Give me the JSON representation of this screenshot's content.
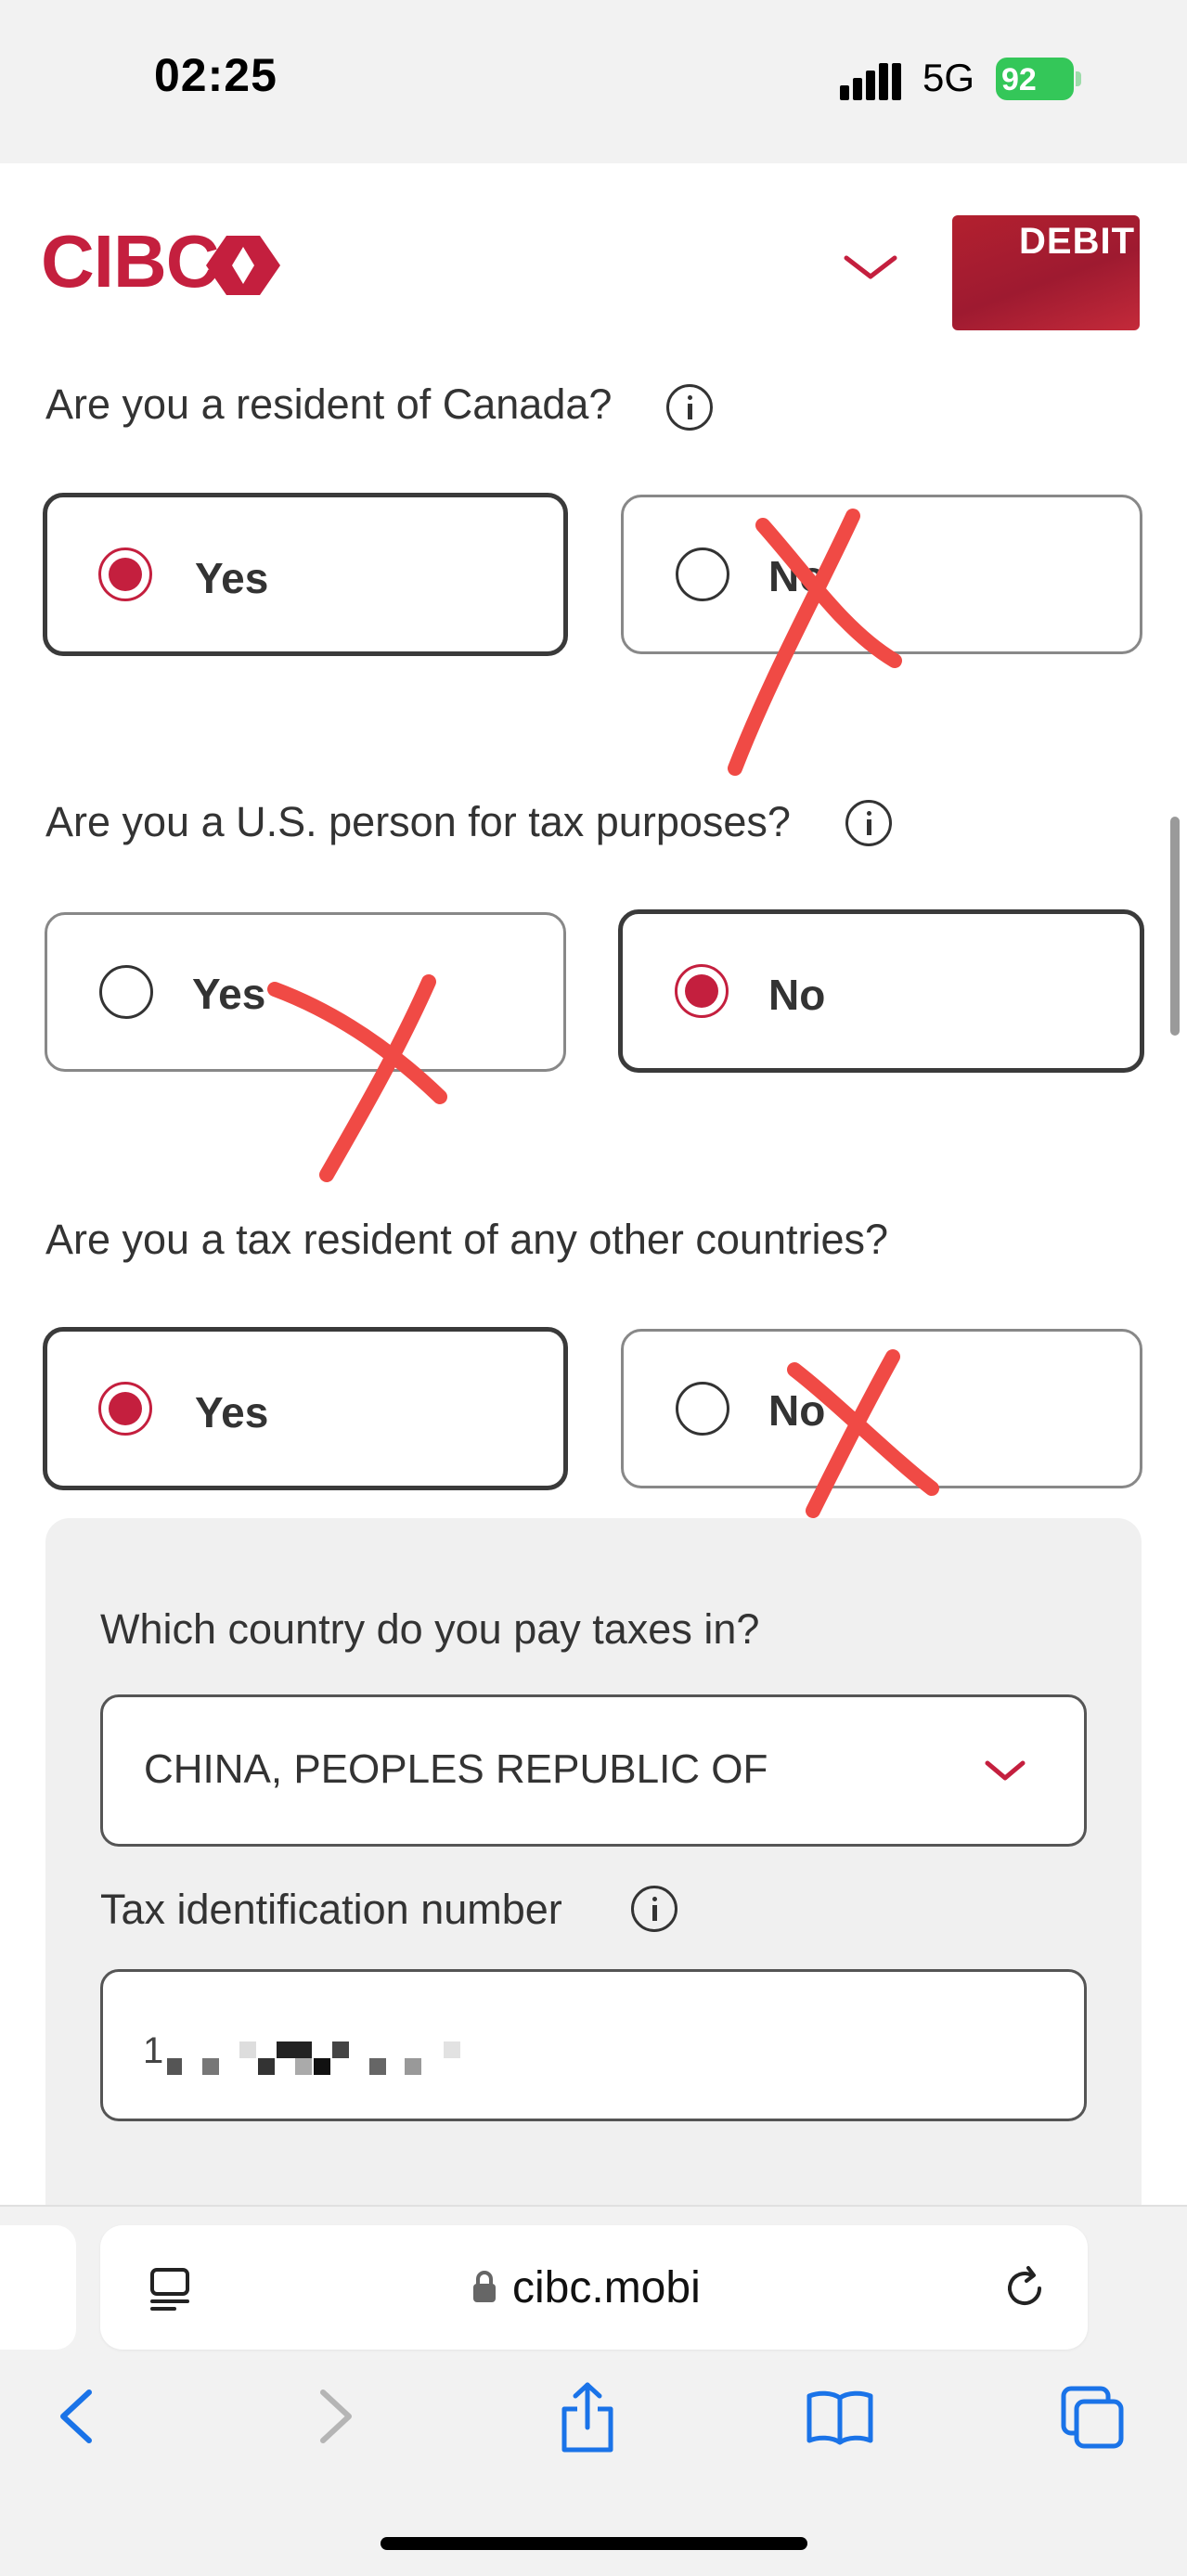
{
  "status_bar": {
    "time": "02:25",
    "network": "5G",
    "battery": "92"
  },
  "header": {
    "logo_text": "CIBC",
    "card_label": "DEBIT"
  },
  "questions": [
    {
      "text": "Are you a resident of Canada?",
      "options": [
        {
          "label": "Yes",
          "selected": true
        },
        {
          "label": "No",
          "selected": false
        }
      ]
    },
    {
      "text": "Are you a U.S. person for tax purposes?",
      "options": [
        {
          "label": "Yes",
          "selected": false
        },
        {
          "label": "No",
          "selected": true
        }
      ]
    },
    {
      "text": "Are you a tax resident of any other countries?",
      "options": [
        {
          "label": "Yes",
          "selected": true
        },
        {
          "label": "No",
          "selected": false
        }
      ]
    }
  ],
  "tax_section": {
    "country_question": "Which country do you pay taxes in?",
    "country_value": "CHINA, PEOPLES REPUBLIC OF",
    "tin_label": "Tax identification number",
    "tin_value_visible": "1"
  },
  "browser": {
    "url": "cibc.mobi"
  },
  "colors": {
    "brand_red": "#c41f3e",
    "annotation_red": "#f04a45"
  },
  "icons": [
    "info-icon",
    "chevron-down-icon",
    "reader-icon",
    "lock-icon",
    "reload-icon",
    "back-icon",
    "forward-icon",
    "share-icon",
    "bookmarks-icon",
    "tabs-icon"
  ]
}
